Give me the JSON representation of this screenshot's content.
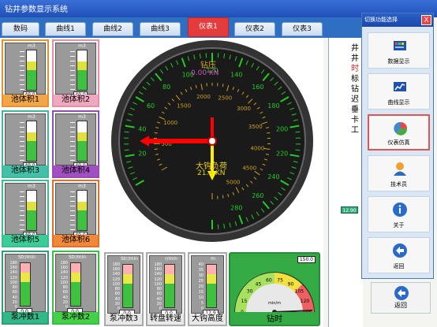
{
  "window": {
    "title": "钻井参数显示系统"
  },
  "tabs": [
    {
      "label": "数码",
      "active": false
    },
    {
      "label": "曲线1",
      "active": false
    },
    {
      "label": "曲线2",
      "active": false
    },
    {
      "label": "曲线3",
      "active": false
    },
    {
      "label": "仪表1",
      "active": true
    },
    {
      "label": "仪表2",
      "active": false
    },
    {
      "label": "仪表3",
      "active": false
    }
  ],
  "tanks": [
    {
      "label": "池体积1",
      "unit": "m3",
      "value": "40.0",
      "level": 0.72,
      "frame": "#e8902a",
      "labelBg": "#f2a64a"
    },
    {
      "label": "池体积2",
      "unit": "m3",
      "value": "40.0",
      "level": 0.72,
      "frame": "#e88fa8",
      "labelBg": "#f0a8c0"
    },
    {
      "label": "池体积3",
      "unit": "m3",
      "value": "40.0",
      "level": 0.72,
      "frame": "#3cb89a",
      "labelBg": "#44c0a8"
    },
    {
      "label": "池体积4",
      "unit": "m3",
      "value": "40.0",
      "level": 0.72,
      "frame": "#9a4ab0",
      "labelBg": "#a050c0"
    },
    {
      "label": "池体积5",
      "unit": "m3",
      "value": "40.0",
      "level": 0.72,
      "frame": "#36c090",
      "labelBg": "#3ccc98"
    },
    {
      "label": "池体积6",
      "unit": "m3",
      "value": "40.0",
      "level": 0.72,
      "frame": "#e0702a",
      "labelBg": "#f08a3a"
    }
  ],
  "bottom_gauges": [
    {
      "label": "泵冲数1",
      "unit": "Str/min",
      "value": "0.0",
      "ticks": [
        "180",
        "160",
        "140",
        "120",
        "100",
        "80",
        "60",
        "40",
        "20",
        "0"
      ],
      "frame": "#2aa07a",
      "labelBg": "#34b888"
    },
    {
      "label": "泵冲数2",
      "unit": "Str/min",
      "value": "0.0",
      "ticks": [
        "180",
        "160",
        "140",
        "120",
        "100",
        "80",
        "60",
        "40",
        "20",
        "0"
      ],
      "frame": "#3ac040",
      "labelBg": "#44d048"
    },
    {
      "label": "泵冲数3",
      "unit": "Str/min",
      "value": "0.0",
      "ticks": [
        "180",
        "160",
        "140",
        "120",
        "100",
        "80",
        "60",
        "40",
        "20",
        "0"
      ],
      "frame": "#aaaaaa",
      "labelBg": "#e8e8e8"
    },
    {
      "label": "转盘转速",
      "unit": "r/min",
      "value": "0.0",
      "ticks": [
        "180",
        "160",
        "140",
        "120",
        "100",
        "80",
        "60",
        "40",
        "20",
        "0"
      ],
      "frame": "#aaaaaa",
      "labelBg": "#e8e8e8"
    },
    {
      "label": "大钩高度",
      "unit": "m",
      "value": "12.9",
      "ticks": [
        "40",
        "35",
        "30",
        "25",
        "20",
        "15",
        "10",
        "5",
        "0"
      ],
      "frame": "#aaaaaa",
      "labelBg": "#e8e8e8"
    }
  ],
  "main_dial": {
    "top_label": "钻压",
    "top_value": "0.00 KN",
    "center_label": "大钩负荷",
    "center_value": "21.4 KN",
    "outer_ticks": [
      "20",
      "40",
      "60",
      "80",
      "100",
      "120",
      "140",
      "160",
      "180",
      "200",
      "220",
      "240",
      "260",
      "280"
    ],
    "inner_ticks": [
      "500",
      "1000",
      "1500",
      "2000",
      "2500",
      "3000",
      "3500",
      "4000",
      "4500",
      "5000"
    ]
  },
  "drill_time": {
    "label": "钻时",
    "value": "150.0",
    "unit": "min/m",
    "ticks": [
      "0",
      "15",
      "30",
      "45",
      "60",
      "75",
      "90",
      "105",
      "120",
      "135"
    ]
  },
  "right_info": {
    "chars": [
      "井",
      "井",
      "时",
      "标",
      "钻",
      "迟",
      "垂",
      "卡",
      "工"
    ],
    "badge": "12.90"
  },
  "popup": {
    "title": "切换功能选择",
    "close": "X",
    "buttons": [
      {
        "label": "数据显示",
        "icon": "data-display-icon"
      },
      {
        "label": "曲线显示",
        "icon": "curve-display-icon"
      },
      {
        "label": "仪表仿真",
        "icon": "gauge-sim-icon",
        "selected": true
      },
      {
        "label": "技术员",
        "icon": "technician-icon"
      },
      {
        "label": "关于",
        "icon": "info-icon"
      },
      {
        "label": "返回",
        "icon": "back-icon"
      }
    ],
    "external_back": "返回"
  },
  "colors": {
    "tab_active": "#e23c3c",
    "tab_bar": "#2f6fc3",
    "gauge_green": "#22cc22",
    "needle_red": "#ff0000",
    "needle_yellow": "#ffee00"
  }
}
